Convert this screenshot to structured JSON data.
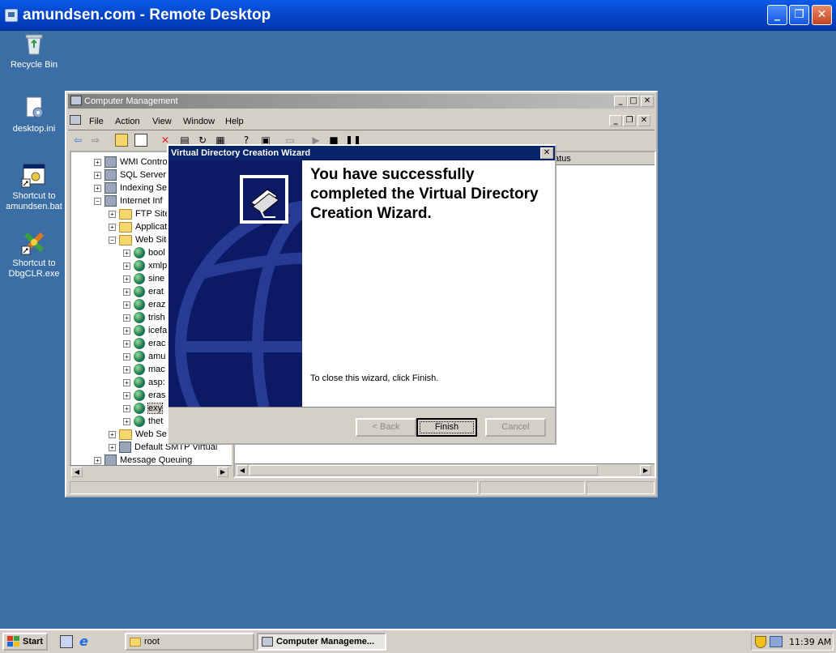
{
  "rdp": {
    "title": "amundsen.com - Remote Desktop"
  },
  "desktop_icons": [
    {
      "label1": "Recycle Bin",
      "label2": ""
    },
    {
      "label1": "desktop.ini",
      "label2": ""
    },
    {
      "label1": "Shortcut to",
      "label2": "amundsen.bat"
    },
    {
      "label1": "Shortcut to",
      "label2": "DbgCLR.exe"
    }
  ],
  "cm": {
    "title": "Computer Management",
    "menu": [
      "File",
      "Action",
      "View",
      "Window",
      "Help"
    ],
    "tree": [
      {
        "label": "WMI Contro",
        "icon": "wmi-icon"
      },
      {
        "label": "SQL Server",
        "icon": "sql-server-icon"
      },
      {
        "label": "Indexing Se",
        "icon": "indexing-icon"
      },
      {
        "label": "Internet Inf",
        "icon": "iis-icon"
      },
      {
        "label": "FTP Site",
        "icon": "folder-icon"
      },
      {
        "label": "Applicat",
        "icon": "folder-icon"
      },
      {
        "label": "Web Site",
        "icon": "folder-icon"
      },
      {
        "label": "bool",
        "icon": "globe-icon"
      },
      {
        "label": "xmlp",
        "icon": "globe-icon"
      },
      {
        "label": "sine",
        "icon": "globe-icon"
      },
      {
        "label": "erat",
        "icon": "globe-icon"
      },
      {
        "label": "eraz",
        "icon": "globe-icon"
      },
      {
        "label": "trish",
        "icon": "globe-icon"
      },
      {
        "label": "icefa",
        "icon": "globe-icon"
      },
      {
        "label": "erac",
        "icon": "globe-icon"
      },
      {
        "label": "amu",
        "icon": "globe-icon"
      },
      {
        "label": "mac",
        "icon": "globe-icon"
      },
      {
        "label": "asp:",
        "icon": "globe-icon"
      },
      {
        "label": "eras",
        "icon": "globe-icon"
      },
      {
        "label": "exy",
        "icon": "globe-icon"
      },
      {
        "label": "thet",
        "icon": "globe-icon"
      },
      {
        "label": "Web Ser",
        "icon": "folder-icon"
      },
      {
        "label": "Default SMTP Virtual",
        "icon": "smtp-icon"
      },
      {
        "label": "Message Queuing",
        "icon": "message-queuing-icon"
      }
    ],
    "right_header": "atus"
  },
  "wizard": {
    "title": "Virtual Directory Creation Wizard",
    "heading": "You have successfully completed the Virtual Directory Creation Wizard.",
    "hint": "To close this wizard, click Finish.",
    "back_label": "< Back",
    "finish_label": "Finish",
    "cancel_label": "Cancel"
  },
  "taskbar": {
    "start_label": "Start",
    "tasks": [
      "root",
      "Computer Manageme..."
    ],
    "clock": "11:39 AM"
  }
}
